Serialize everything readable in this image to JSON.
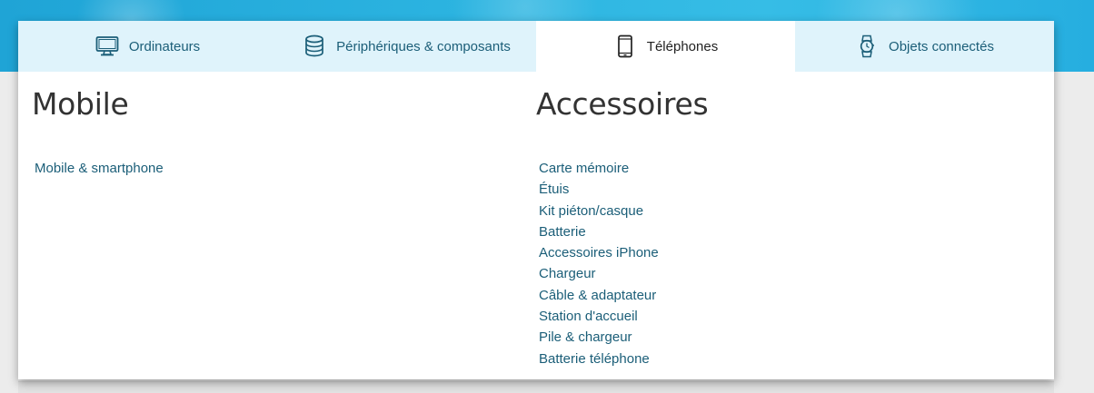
{
  "tabs": [
    {
      "label": "Ordinateurs",
      "icon": "monitor-icon",
      "active": false
    },
    {
      "label": "Périphériques & composants",
      "icon": "database-icon",
      "active": false
    },
    {
      "label": "Téléphones",
      "icon": "smartphone-icon",
      "active": true
    },
    {
      "label": "Objets connectés",
      "icon": "smartwatch-icon",
      "active": false
    }
  ],
  "columns": [
    {
      "title": "Mobile",
      "links": [
        "Mobile & smartphone"
      ]
    },
    {
      "title": "Accessoires",
      "links": [
        "Carte mémoire",
        "Étuis",
        "Kit piéton/casque",
        "Batterie",
        "Accessoires iPhone",
        "Chargeur",
        "Câble & adaptateur",
        "Station d'accueil",
        "Pile & chargeur",
        "Batterie téléphone"
      ]
    }
  ],
  "colors": {
    "banner": "#2bb3e0",
    "tab_bar": "#dff3fb",
    "link": "#1b5e78",
    "heading": "#333333"
  }
}
